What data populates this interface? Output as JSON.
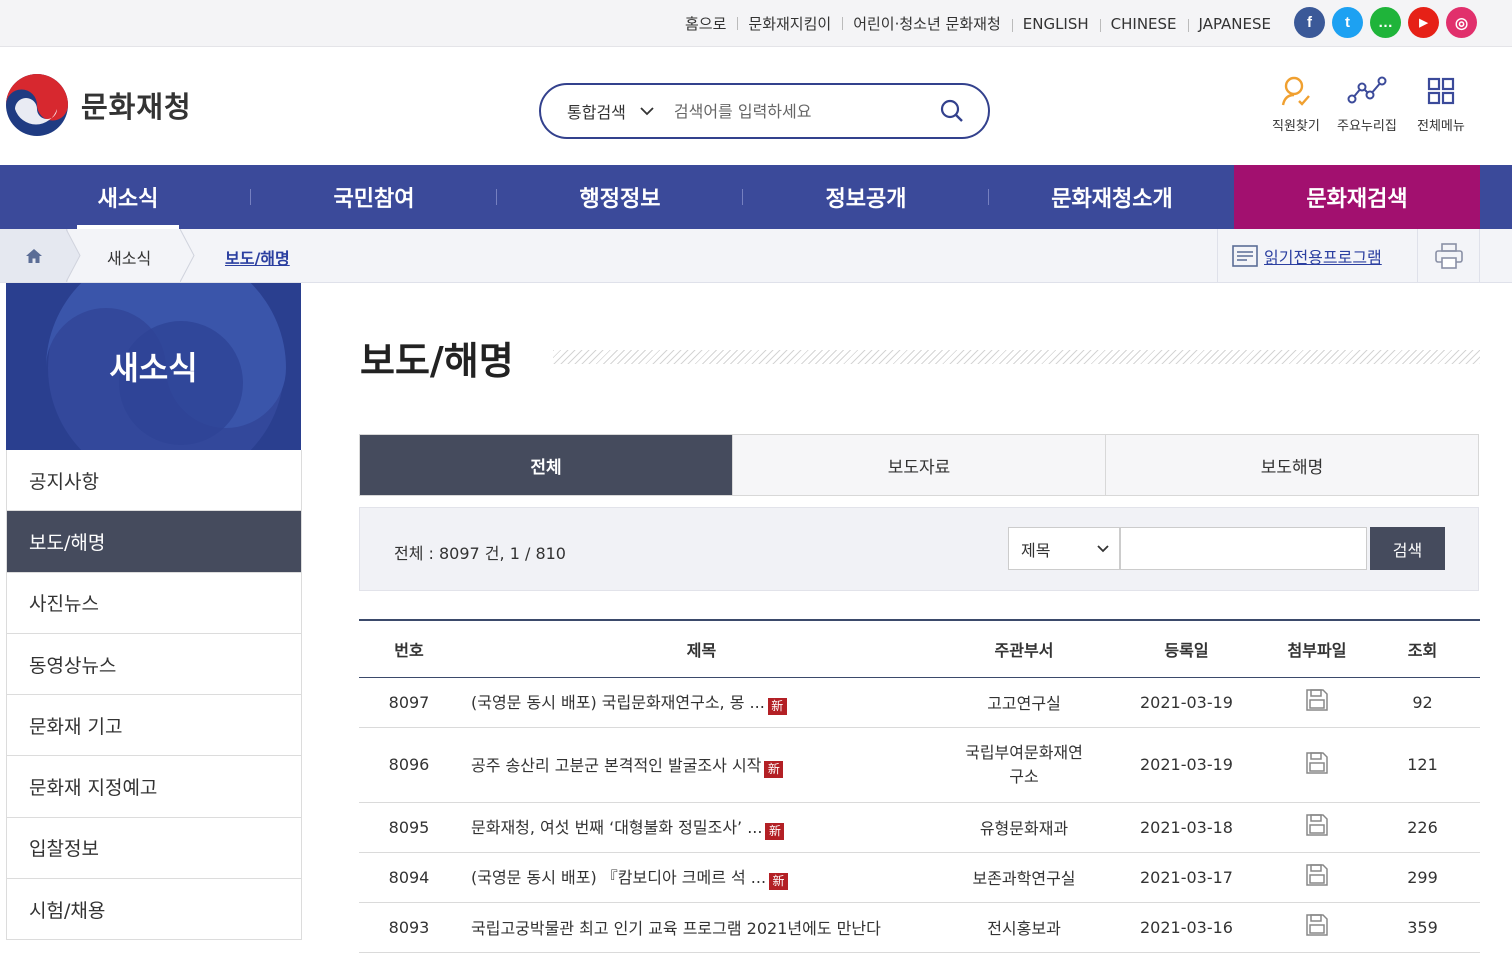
{
  "utility": {
    "links": [
      "홈으로",
      "문화재지킴이",
      "어린이·청소년 문화재청",
      "ENGLISH",
      "CHINESE",
      "JAPANESE"
    ],
    "sns": [
      {
        "name": "facebook-icon",
        "glyph": "f",
        "color": "#3b5998"
      },
      {
        "name": "twitter-icon",
        "glyph": "t",
        "color": "#1da1f2"
      },
      {
        "name": "talk-icon",
        "glyph": "…",
        "color": "#1fb43a"
      },
      {
        "name": "youtube-icon",
        "glyph": "▶",
        "color": "#e62117"
      },
      {
        "name": "instagram-icon",
        "glyph": "◎",
        "color": "#e1306c"
      }
    ]
  },
  "header": {
    "logo_text": "문화재청",
    "search_scope": "통합검색",
    "search_placeholder": "검색어를 입력하세요",
    "quick_links": [
      "직원찾기",
      "주요누리집",
      "전체메뉴"
    ]
  },
  "gnb": [
    "새소식",
    "국민참여",
    "행정정보",
    "정보공개",
    "문화재청소개",
    "문화재검색"
  ],
  "breadcrumb": {
    "level1": "새소식",
    "current": "보도/해명",
    "reader": "읽기전용프로그램"
  },
  "lnb": {
    "title": "새소식",
    "items": [
      "공지사항",
      "보도/해명",
      "사진뉴스",
      "동영상뉴스",
      "문화재 기고",
      "문화재 지정예고",
      "입찰정보",
      "시험/채용"
    ]
  },
  "content": {
    "title": "보도/해명",
    "tabs": [
      "전체",
      "보도자료",
      "보도해명"
    ],
    "filter": {
      "total": "전체 : 8097 건, 1 / 810",
      "select": "제목",
      "button": "검색"
    },
    "columns": [
      "번호",
      "제목",
      "주관부서",
      "등록일",
      "첨부파일",
      "조회"
    ],
    "new_badge": "新",
    "rows": [
      {
        "no": "8097",
        "title": "(국영문 동시 배포) 국립문화재연구소, 몽 ...",
        "dept": "고고연구실",
        "date": "2021-03-19",
        "views": "92"
      },
      {
        "no": "8096",
        "title": "공주 송산리 고분군 본격적인 발굴조사 시작",
        "dept": "국립부여문화재연구소",
        "date": "2021-03-19",
        "views": "121"
      },
      {
        "no": "8095",
        "title": "문화재청, 여섯 번째 ‘대형불화 정밀조사’ ...",
        "dept": "유형문화재과",
        "date": "2021-03-18",
        "views": "226"
      },
      {
        "no": "8094",
        "title": "(국영문 동시 배포) 『캄보디아 크메르 석 ...",
        "dept": "보존과학연구실",
        "date": "2021-03-17",
        "views": "299"
      },
      {
        "no": "8093",
        "title": "국립고궁박물관 최고 인기 교육 프로그램 2021년에도 만난다",
        "dept": "전시홍보과",
        "date": "2021-03-16",
        "views": "359"
      }
    ]
  }
}
